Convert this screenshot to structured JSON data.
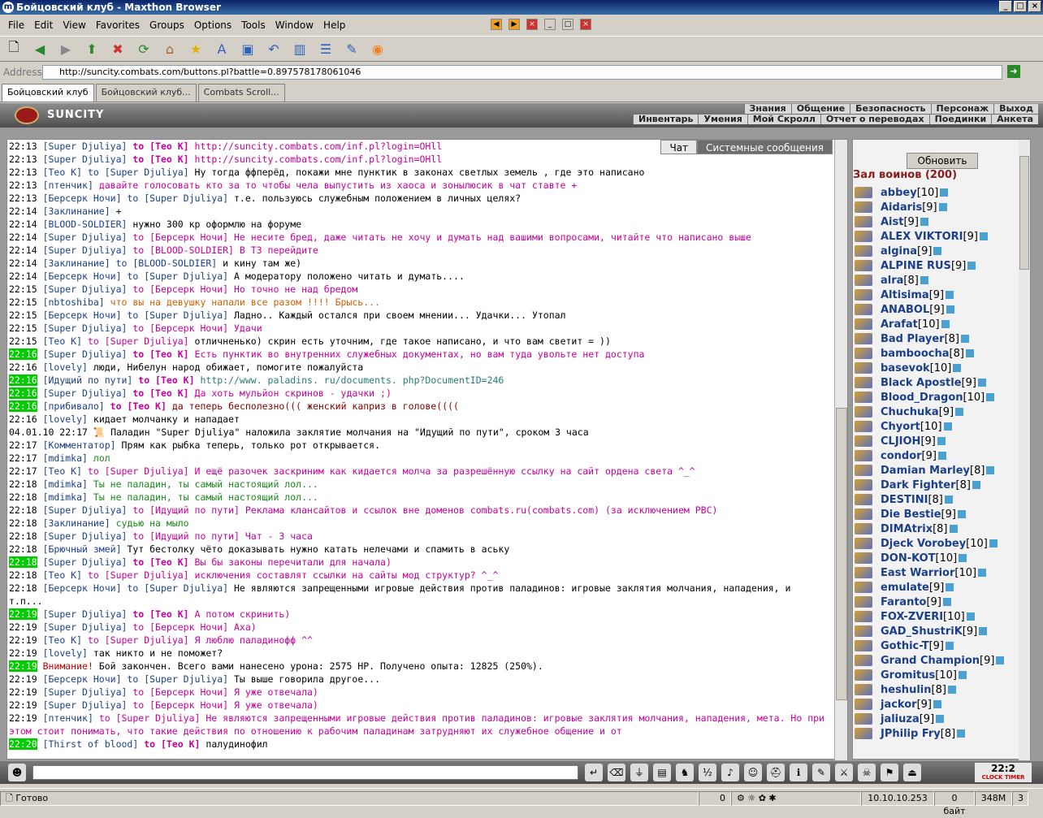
{
  "window": {
    "title": "Бойцовский клуб - Maxthon Browser"
  },
  "menu": [
    "File",
    "Edit",
    "View",
    "Favorites",
    "Groups",
    "Options",
    "Tools",
    "Window",
    "Help"
  ],
  "address": {
    "label": "Address",
    "url": "http://suncity.combats.com/buttons.pl?battle=0.897578178061046"
  },
  "tabs": [
    "Бойцовский клуб",
    "Бойцовский клуб...",
    "Combats Scroll..."
  ],
  "game": {
    "logo": "SUNCITY",
    "nav_top": [
      "Знания",
      "Общение",
      "Безопасность",
      "Персонаж",
      "Выход"
    ],
    "nav_bottom": [
      "Инвентарь",
      "Умения",
      "Мой Скролл",
      "Отчет о переводах",
      "Поединки",
      "Анкета"
    ]
  },
  "chat_tabs": [
    "Чат",
    "Системные сообщения"
  ],
  "chat": [
    {
      "t": "22:13",
      "nick": "[Super Djuliya]",
      "to": "to [Teo K]",
      "tostyle": "tobold",
      "msg": "http://suncity.combats.com/inf.pl?login=OHll",
      "msgstyle": "pink"
    },
    {
      "t": "22:13",
      "nick": "[Super Djuliya]",
      "to": "to [Teo K]",
      "tostyle": "tobold",
      "msg": "http://suncity.combats.com/inf.pl?login=OHll",
      "msgstyle": "pink"
    },
    {
      "t": "22:13",
      "nick": "[Teo K]",
      "to": "to [Super Djuliya]",
      "tostyle": "to",
      "msg": "Ну тогда ффперёд, покажи мне пунктик в законах светлых земель , где это написано",
      "msgstyle": "sys"
    },
    {
      "t": "22:13",
      "nick": "[птенчик]",
      "to": "",
      "msg": "давайте голосовать кто за то чтобы чела выпустить из хаоса и зонылюсик в чат ставте +",
      "msgstyle": "pink"
    },
    {
      "t": "22:13",
      "nick": "[Берсерк Ночи]",
      "to": "to [Super Djuliya]",
      "tostyle": "to",
      "msg": "т.е. пользуюсь служебным положением в личных целях?",
      "msgstyle": "sys"
    },
    {
      "t": "22:14",
      "nick": "[Заклинание]",
      "to": "",
      "msg": "+",
      "msgstyle": "sys"
    },
    {
      "t": "22:14",
      "nick": "[BLOOD-SOLDIER]",
      "to": "",
      "msg": "нужно 300 кр оформлю на форуме",
      "msgstyle": "sys"
    },
    {
      "t": "22:14",
      "nick": "[Super Djuliya]",
      "to": "to [Берсерк Ночи]",
      "tostyle": "pink",
      "msg": "Не несите бред, даже читать не хочу и думать над вашими вопросами, читайте что написано выше",
      "msgstyle": "pink"
    },
    {
      "t": "22:14",
      "nick": "[Super Djuliya]",
      "to": "to [BLOOD-SOLDIER]",
      "tostyle": "pink",
      "msg": "В ТЗ перейдите",
      "msgstyle": "pink"
    },
    {
      "t": "22:14",
      "nick": "[Заклинание]",
      "to": "to [BLOOD-SOLDIER]",
      "tostyle": "to",
      "msg": "и кину там же)",
      "msgstyle": "sys"
    },
    {
      "t": "22:14",
      "nick": "[Берсерк Ночи]",
      "to": "to [Super Djuliya]",
      "tostyle": "to",
      "msg": "А модератору положено читать и думать....",
      "msgstyle": "sys"
    },
    {
      "t": "22:15",
      "nick": "[Super Djuliya]",
      "to": "to [Берсерк Ночи]",
      "tostyle": "pink",
      "msg": "Но точно не над бредом",
      "msgstyle": "pink"
    },
    {
      "t": "22:15",
      "nick": "[nbtoshiba]",
      "to": "",
      "msg": "что вы на девушку напали все разом !!!! Брысь...",
      "msgstyle": "orange"
    },
    {
      "t": "22:15",
      "nick": "[Берсерк Ночи]",
      "to": "to [Super Djuliya]",
      "tostyle": "to",
      "msg": "Ладно.. Каждый остался при своем мнении... Удачки... Утопал",
      "msgstyle": "sys"
    },
    {
      "t": "22:15",
      "nick": "[Super Djuliya]",
      "to": "to [Берсерк Ночи]",
      "tostyle": "pink",
      "msg": "Удачи",
      "msgstyle": "pink"
    },
    {
      "t": "22:15",
      "nick": "[Teo K]",
      "to": "to [Super Djuliya]",
      "tostyle": "pink",
      "msg": "отличненько) скрин есть уточним, где такое написано, и что вам светит = ))",
      "msgstyle": "sys"
    },
    {
      "t": "22:16",
      "hl": true,
      "nick": "[Super Djuliya]",
      "to": "to [Teo K]",
      "tostyle": "tobold",
      "msg": "Есть пунктик во внутренних служебных документах, но вам туда увольте нет доступа",
      "msgstyle": "pink"
    },
    {
      "t": "22:16",
      "nick": "[lovely]",
      "to": "",
      "msg": "люди, Нибелун народ обижает, помогите пожалуйста",
      "msgstyle": "sys"
    },
    {
      "t": "22:16",
      "hl": true,
      "nick": "[Идущий по пути]",
      "to": "to [Teo K]",
      "tostyle": "tobold",
      "msg": "http://www. paladins. ru/documents. php?DocumentID=246",
      "msgstyle": "teal"
    },
    {
      "t": "22:16",
      "hl": true,
      "nick": "[Super Djuliya]",
      "to": "to [Teo K]",
      "tostyle": "tobold",
      "msg": "Да хоть мульйон скринов - удачки ;)",
      "msgstyle": "pink"
    },
    {
      "t": "22:16",
      "hl": true,
      "nick": "[прибивало]",
      "to": "to [Teo K]",
      "tostyle": "tobold",
      "msg": "да теперь бесполезно((( женский каприз в голове((((",
      "msgstyle": "darkred"
    },
    {
      "t": "22:16",
      "nick": "[lovely]",
      "to": "",
      "msg": "кидает молчанку и нападает",
      "msgstyle": "sys"
    },
    {
      "t": "04.01.10 22:17",
      "nick": "",
      "to": "",
      "msg": "Паладин \"Super Djuliya\" наложила заклятие молчания на \"Идущий по пути\", сроком 3 часа",
      "msgstyle": "sys",
      "special": "silence"
    },
    {
      "t": "22:17",
      "nick": "[Комментатор]",
      "to": "",
      "msg": "Прям как рыбка теперь, только рот открывается.",
      "msgstyle": "sys"
    },
    {
      "t": "22:17",
      "nick": "[mdimka]",
      "to": "",
      "msg": "лол",
      "msgstyle": "green"
    },
    {
      "t": "22:17",
      "nick": "[Teo K]",
      "to": "to [Super Djuliya]",
      "tostyle": "pink",
      "msg": "И ещё разочек заскриним как кидается молча за разрешённую ссылку на сайт ордена света ^_^",
      "msgstyle": "pink"
    },
    {
      "t": "22:18",
      "nick": "[mdimka]",
      "to": "",
      "msg": "Ты не паладин, ты самый настоящий лол...",
      "msgstyle": "green"
    },
    {
      "t": "22:18",
      "nick": "[mdimka]",
      "to": "",
      "msg": "Ты не паладин, ты самый настоящий лол...",
      "msgstyle": "green"
    },
    {
      "t": "22:18",
      "nick": "[Super Djuliya]",
      "to": "to [Идущий по пути]",
      "tostyle": "pink",
      "msg": "Реклама клансайтов и ссылок вне доменов combats.ru(combats.com) (за исключением PBC)",
      "msgstyle": "pink"
    },
    {
      "t": "22:18",
      "nick": "[Заклинание]",
      "to": "",
      "msg": "судью на мыло",
      "msgstyle": "green"
    },
    {
      "t": "22:18",
      "nick": "[Super Djuliya]",
      "to": "to [Идущий по пути]",
      "tostyle": "pink",
      "msg": "Чат - 3 часа",
      "msgstyle": "pink"
    },
    {
      "t": "22:18",
      "nick": "[Брючный змей]",
      "to": "",
      "msg": "Тут бестолку чёто доказывать нужно катать нелечами и спамить в аську",
      "msgstyle": "sys"
    },
    {
      "t": "22:18",
      "hl": true,
      "nick": "[Super Djuliya]",
      "to": "to [Teo K]",
      "tostyle": "tobold",
      "msg": "Вы бы законы перечитали для начала)",
      "msgstyle": "pink"
    },
    {
      "t": "22:18",
      "nick": "[Teo K]",
      "to": "to [Super Djuliya]",
      "tostyle": "pink",
      "msg": "исключения составлят ссылки на сайты мод структур? ^_^",
      "msgstyle": "pink"
    },
    {
      "t": "22:18",
      "nick": "[Берсерк Ночи]",
      "to": "to [Super Djuliya]",
      "tostyle": "to",
      "msg": "Не являются запрещенными игровые действия против паладинов: игровые заклятия молчания, нападения, и т.п...",
      "msgstyle": "sys",
      "wrap": true
    },
    {
      "t": "22:19",
      "hl": true,
      "nick": "[Super Djuliya]",
      "to": "to [Teo K]",
      "tostyle": "tobold",
      "msg": "А потом скринить)",
      "msgstyle": "pink"
    },
    {
      "t": "22:19",
      "nick": "[Super Djuliya]",
      "to": "to [Берсерк Ночи]",
      "tostyle": "pink",
      "msg": "Аха)",
      "msgstyle": "pink"
    },
    {
      "t": "22:19",
      "nick": "[Teo K]",
      "to": "to [Super Djuliya]",
      "tostyle": "pink",
      "msg": "Я люблю паладинофф ^^",
      "msgstyle": "pink"
    },
    {
      "t": "22:19",
      "nick": "[lovely]",
      "to": "",
      "msg": "так никто и не поможет?",
      "msgstyle": "sys"
    },
    {
      "t": "22:19",
      "hl": true,
      "nick": "",
      "to": "",
      "msg": "Внимание! Бой закончен. Всего вами нанесено урона: 2575 HP. Получено опыта: 12825 (250%).",
      "msgstyle": "sys",
      "special": "battle"
    },
    {
      "t": "22:19",
      "nick": "[Берсерк Ночи]",
      "to": "to [Super Djuliya]",
      "tostyle": "to",
      "msg": "Ты выше говорила другое...",
      "msgstyle": "sys"
    },
    {
      "t": "22:19",
      "nick": "[Super Djuliya]",
      "to": "to [Берсерк Ночи]",
      "tostyle": "pink",
      "msg": "Я уже отвечала)",
      "msgstyle": "pink"
    },
    {
      "t": "22:19",
      "nick": "[Super Djuliya]",
      "to": "to [Берсерк Ночи]",
      "tostyle": "pink",
      "msg": "Я уже отвечала)",
      "msgstyle": "pink"
    },
    {
      "t": "22:19",
      "nick": "[птенчик]",
      "to": "to [Super Djuliya]",
      "tostyle": "pink",
      "msg": "Не являются запрещенными игровые действия против паладинов: игровые заклятия молчания, нападения, мета. Но при этом стоит понимать, что такие действия по отношению к рабочим паладинам затрудняют их служебное общение и от",
      "msgstyle": "pink",
      "wrap": true
    },
    {
      "t": "22:20",
      "hl": true,
      "nick": "[Thirst of blood]",
      "to": "to [Teo K]",
      "tostyle": "tobold",
      "msg": "палудинофил",
      "msgstyle": "sys"
    }
  ],
  "sidebar": {
    "refresh": "Обновить",
    "hall": "Зал воинов (200)",
    "players": [
      {
        "name": "abbey",
        "lvl": "[10]"
      },
      {
        "name": "Aidaris",
        "lvl": "[9]"
      },
      {
        "name": "Aist",
        "lvl": "[9]"
      },
      {
        "name": "ALEX VIKTORI",
        "lvl": "[9]"
      },
      {
        "name": "algina",
        "lvl": "[9]"
      },
      {
        "name": "ALPINE RUS",
        "lvl": "[9]"
      },
      {
        "name": "alra",
        "lvl": "[8]"
      },
      {
        "name": "Altisima",
        "lvl": "[9]"
      },
      {
        "name": "ANABOL",
        "lvl": "[9]"
      },
      {
        "name": "Arafat",
        "lvl": "[10]"
      },
      {
        "name": "Bad Player",
        "lvl": "[8]"
      },
      {
        "name": "bamboocha",
        "lvl": "[8]"
      },
      {
        "name": "basevok",
        "lvl": "[10]"
      },
      {
        "name": "Black Apostle",
        "lvl": "[9]"
      },
      {
        "name": "Blood_Dragon",
        "lvl": "[10]"
      },
      {
        "name": "Chuchuka",
        "lvl": "[9]"
      },
      {
        "name": "Chyort",
        "lvl": "[10]"
      },
      {
        "name": "CLJIOH",
        "lvl": "[9]"
      },
      {
        "name": "condor",
        "lvl": "[9]"
      },
      {
        "name": "Damian Marley",
        "lvl": "[8]"
      },
      {
        "name": "Dark Fighter",
        "lvl": "[8]"
      },
      {
        "name": "DESTINI",
        "lvl": "[8]"
      },
      {
        "name": "Die Bestie",
        "lvl": "[9]"
      },
      {
        "name": "DIMAtrix",
        "lvl": "[8]"
      },
      {
        "name": "Djeck Vorobey",
        "lvl": "[10]"
      },
      {
        "name": "DON-KOT",
        "lvl": "[10]"
      },
      {
        "name": "East Warrior",
        "lvl": "[10]"
      },
      {
        "name": "emulate",
        "lvl": "[9]"
      },
      {
        "name": "Faranto",
        "lvl": "[9]"
      },
      {
        "name": "FOX-ZVERI",
        "lvl": "[10]"
      },
      {
        "name": "GAD_ShustriK",
        "lvl": "[9]"
      },
      {
        "name": "Gothic-T",
        "lvl": "[9]"
      },
      {
        "name": "Grand Champion",
        "lvl": "[9]"
      },
      {
        "name": "Gromitus",
        "lvl": "[10]"
      },
      {
        "name": "heshulin",
        "lvl": "[8]"
      },
      {
        "name": "jackor",
        "lvl": "[9]"
      },
      {
        "name": "jaliuza",
        "lvl": "[9]"
      },
      {
        "name": "JPhilip Fry",
        "lvl": "[8]"
      }
    ]
  },
  "clock": {
    "time": "22:2",
    "label": "CLOCK TIMER"
  },
  "status": {
    "text": "Готово",
    "count": "0",
    "ip": "10.10.10.253",
    "bytes": "0 байт",
    "mem": "348M",
    "n": "3"
  }
}
